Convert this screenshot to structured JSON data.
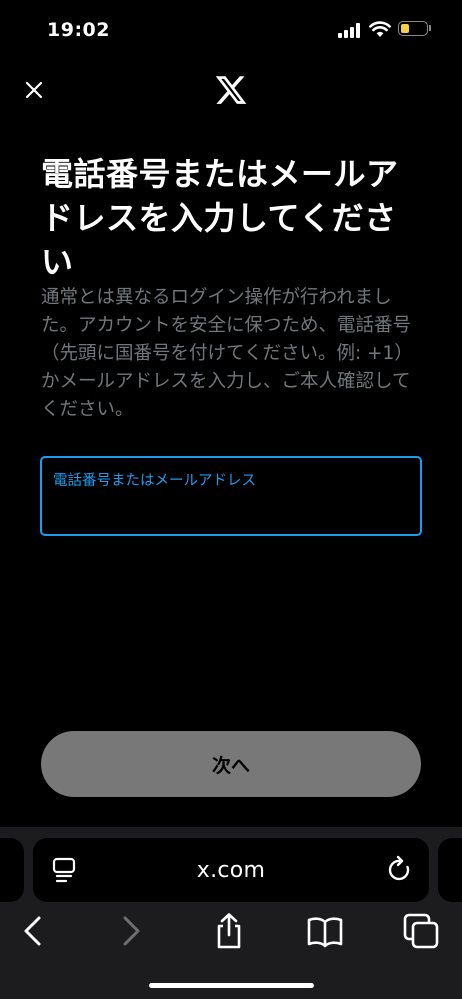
{
  "status_bar": {
    "time": "19:02",
    "battery_level": 0.35
  },
  "header": {
    "close_icon": "close-icon",
    "logo_icon": "x-logo-icon"
  },
  "main": {
    "heading": "電話番号またはメールアドレスを入力してください",
    "description": "通常とは異なるログイン操作が行われました。アカウントを安全に保つため、電話番号（先頭に国番号を付けてください。例: +1）かメールアドレスを入力し、ご本人確認してください。",
    "field": {
      "label": "電話番号またはメールアドレス",
      "value": ""
    },
    "next_button": "次へ"
  },
  "browser": {
    "url": "x.com"
  },
  "colors": {
    "accent": "#1d9bf0",
    "secondary_text": "#71767b",
    "button_disabled": "#787878",
    "battery": "#f7ce46"
  }
}
